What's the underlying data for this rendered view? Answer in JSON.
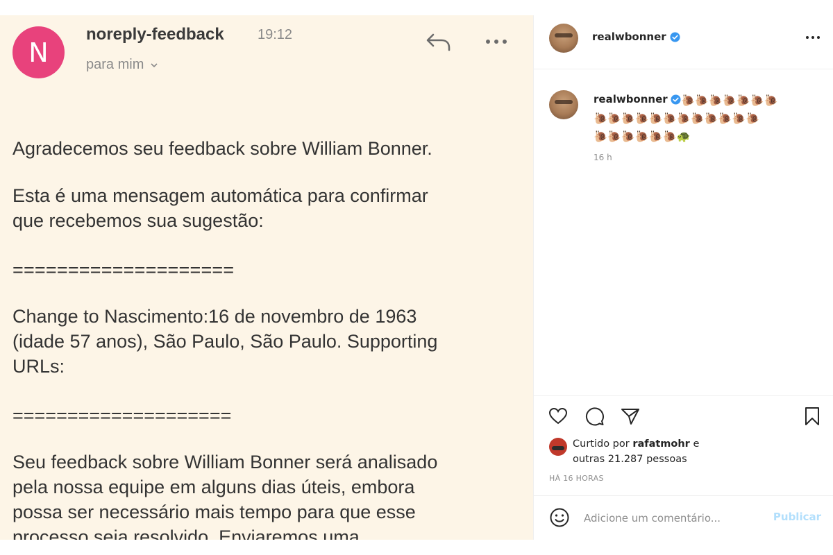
{
  "email": {
    "avatar_letter": "N",
    "sender": "noreply-feedback",
    "time": "19:12",
    "recipient": "para mim",
    "paragraph1": "Agradecemos seu feedback sobre William Bonner.",
    "paragraph2_line1": "Esta é uma mensagem automática para confirmar",
    "paragraph2_line2": "que recebemos sua sugestão:",
    "separator": "====================",
    "paragraph3_line1": "Change to Nascimento:16 de novembro de 1963",
    "paragraph3_line2": "(idade 57 anos), São Paulo, São Paulo. Supporting",
    "paragraph3_line3": "URLs:",
    "paragraph4_line1": "Seu feedback sobre William Bonner será analisado",
    "paragraph4_line2": "pela nossa equipe em alguns dias úteis, embora",
    "paragraph4_line3": "possa ser necessário mais tempo para que esse",
    "paragraph4_line4": "processo seja resolvido. Enviaremos uma",
    "avatar_color": "#e8427c",
    "background_color": "#fdf5e7"
  },
  "instagram": {
    "username": "realwbonner",
    "comment": {
      "username": "realwbonner",
      "emojis_line1": "🐌🐌🐌🐌🐌🐌🐌",
      "emojis_line2": "🐌🐌🐌🐌🐌🐌🐌🐌🐌🐌🐌🐌",
      "emojis_line3": "🐌🐌🐌🐌🐌🐌🐢",
      "time": "16 h"
    },
    "liked_prefix": "Curtido por ",
    "liked_user": "rafatmohr",
    "liked_suffix": " e",
    "liked_line2": "outras 21.287 pessoas",
    "ago": "HÁ 16 HORAS",
    "comment_placeholder": "Adicione um comentário...",
    "publish_label": "Publicar",
    "verified_color": "#3897f0"
  }
}
